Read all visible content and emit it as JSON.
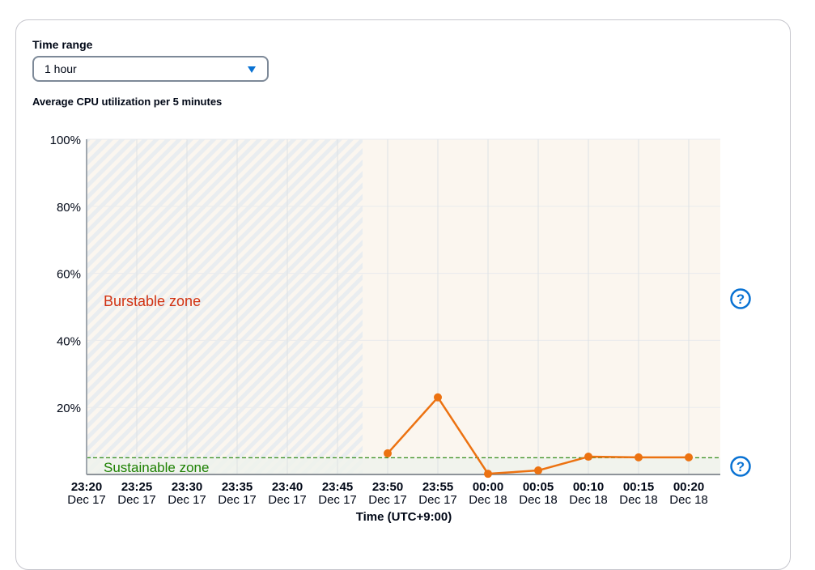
{
  "controls": {
    "time_range_label": "Time range",
    "time_range_value": "1 hour"
  },
  "chart_title": "Average CPU utilization per 5 minutes",
  "zones": {
    "burstable_label": "Burstable zone",
    "sustainable_label": "Sustainable zone"
  },
  "help_icons": [
    "burstable-help",
    "sustainable-help"
  ],
  "colors": {
    "series": "#ec7211",
    "burstable_text": "#d13212",
    "sustainable_text": "#1d8102",
    "baseline": "#1d8102",
    "help": "#0972d3"
  },
  "chart_data": {
    "type": "line",
    "title": "Average CPU utilization per 5 minutes",
    "xlabel": "Time (UTC+9:00)",
    "ylabel": "",
    "ylim": [
      0,
      100
    ],
    "yticks": [
      "100%",
      "80%",
      "60%",
      "40%",
      "20%"
    ],
    "ytick_values": [
      100,
      80,
      60,
      40,
      20
    ],
    "categories": [
      {
        "time": "23:20",
        "date": "Dec 17"
      },
      {
        "time": "23:25",
        "date": "Dec 17"
      },
      {
        "time": "23:30",
        "date": "Dec 17"
      },
      {
        "time": "23:35",
        "date": "Dec 17"
      },
      {
        "time": "23:40",
        "date": "Dec 17"
      },
      {
        "time": "23:45",
        "date": "Dec 17"
      },
      {
        "time": "23:50",
        "date": "Dec 17"
      },
      {
        "time": "23:55",
        "date": "Dec 17"
      },
      {
        "time": "00:00",
        "date": "Dec 18"
      },
      {
        "time": "00:05",
        "date": "Dec 18"
      },
      {
        "time": "00:10",
        "date": "Dec 18"
      },
      {
        "time": "00:15",
        "date": "Dec 18"
      },
      {
        "time": "00:20",
        "date": "Dec 18"
      }
    ],
    "series": [
      {
        "name": "CPU utilization",
        "values": [
          null,
          null,
          null,
          null,
          null,
          null,
          6.3,
          23.0,
          0.2,
          1.2,
          5.3,
          5.1,
          5.1
        ]
      }
    ],
    "baseline_percent": 5,
    "no_data_until_index": 5.5,
    "grid": true,
    "legend": "none"
  }
}
